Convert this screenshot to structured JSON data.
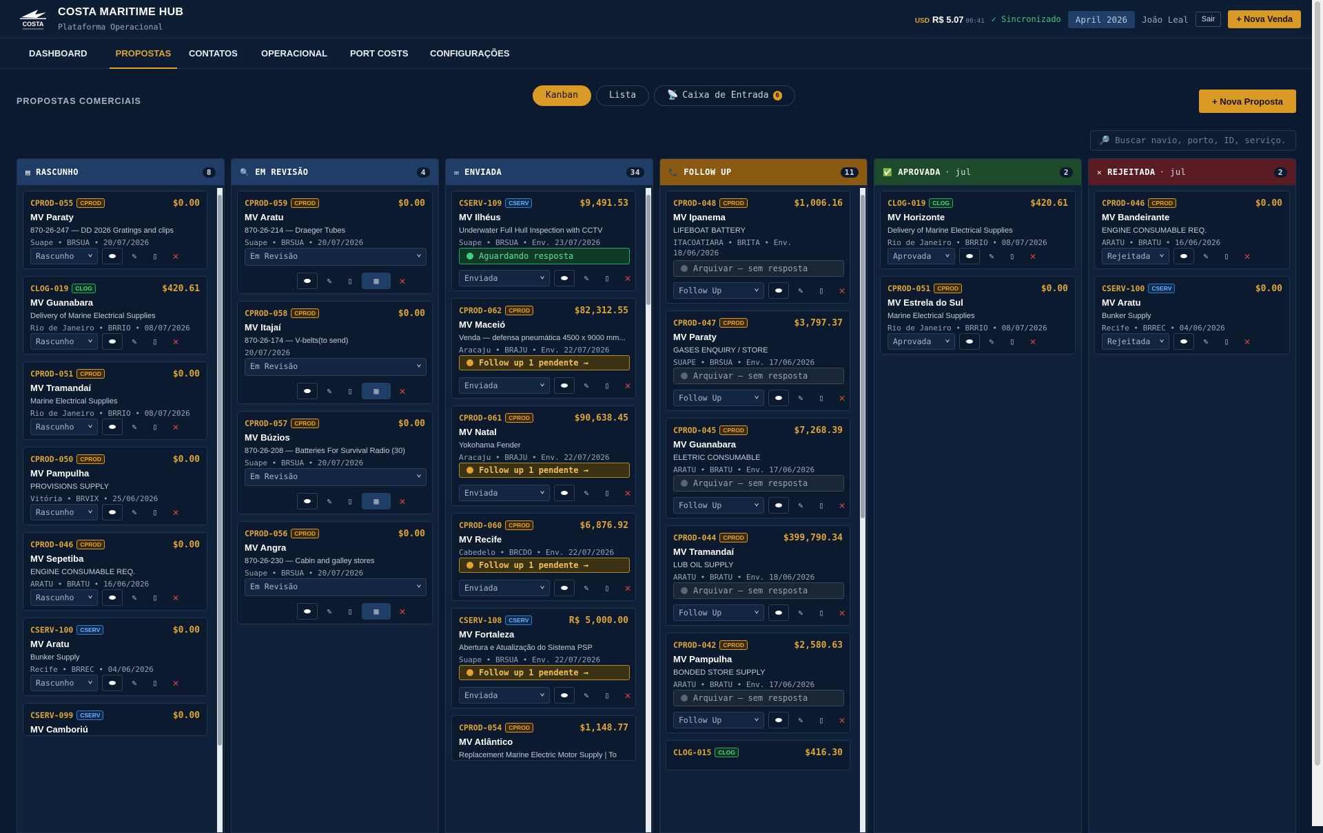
{
  "brand": {
    "title": "COSTA MARITIME HUB",
    "subtitle": "Plataforma Operacional",
    "logo_text": "COSTA"
  },
  "topbar": {
    "rate_currency": "USD",
    "rate_value": "R$ 5.07",
    "rate_time": "00:41",
    "sync": "✓ Sincronizado",
    "month": "April 2026",
    "user": "João Leal",
    "logout": "Sair",
    "new_sale": "+ Nova Venda"
  },
  "nav": [
    "DASHBOARD",
    "PROPOSTAS",
    "CONTATOS",
    "OPERACIONAL",
    "PORT COSTS",
    "CONFIGURAÇÕES"
  ],
  "page": {
    "title": "PROPOSTAS COMERCIAIS",
    "new_proposal": "+ Nova Proposta",
    "search_placeholder": "🔎 Buscar navio, porto, ID, serviço.",
    "views": [
      "Kanban",
      "Lista"
    ],
    "inbox": "Caixa de Entrada",
    "inbox_count": "6"
  },
  "columns": [
    {
      "title": "RASCUNHO",
      "sub": "",
      "count": "8",
      "color": "#1f3d66",
      "icon": "▤"
    },
    {
      "title": "EM REVISÃO",
      "sub": "",
      "count": "4",
      "color": "#1f3d66",
      "icon": "🔍"
    },
    {
      "title": "ENVIADA",
      "sub": "",
      "count": "34",
      "color": "#1f3d66",
      "icon": "✉"
    },
    {
      "title": "FOLLOW UP",
      "sub": "",
      "count": "11",
      "color": "#8a5a12",
      "icon": "📞"
    },
    {
      "title": "APROVADA",
      "sub": "· jul",
      "count": "2",
      "color": "#1d4a2a",
      "icon": "✅"
    },
    {
      "title": "REJEITADA",
      "sub": "· jul",
      "count": "2",
      "color": "#5a1c22",
      "icon": "✕"
    }
  ],
  "cards": {
    "rascunho": [
      {
        "id": "CPROD-055",
        "tag": "CPROD",
        "value": "$0.00",
        "ship": "MV Paraty",
        "desc": "870-26-247 — DD 2026 Gratings and clips",
        "meta": "Suape • BRSUA • 20/07/2026",
        "status": "Rascunho"
      },
      {
        "id": "CLOG-019",
        "tag": "CLOG",
        "value": "$420.61",
        "ship": "MV Guanabara",
        "desc": "Delivery of Marine Electrical Supplies",
        "meta": "Rio de Janeiro • BRRIO • 08/07/2026",
        "status": "Rascunho"
      },
      {
        "id": "CPROD-051",
        "tag": "CPROD",
        "value": "$0.00",
        "ship": "MV Tramandaí",
        "desc": "Marine Electrical Supplies",
        "meta": "Rio de Janeiro • BRRIO • 08/07/2026",
        "status": "Rascunho"
      },
      {
        "id": "CPROD-050",
        "tag": "CPROD",
        "value": "$0.00",
        "ship": "MV Pampulha",
        "desc": "PROVISIONS SUPPLY",
        "meta": "Vitória • BRVIX • 25/06/2026",
        "status": "Rascunho"
      },
      {
        "id": "CPROD-046",
        "tag": "CPROD",
        "value": "$0.00",
        "ship": "MV Sepetiba",
        "desc": "ENGINE CONSUMABLE REQ.",
        "meta": "ARATU • BRATU • 16/06/2026",
        "status": "Rascunho"
      },
      {
        "id": "CSERV-100",
        "tag": "CSERV",
        "value": "$0.00",
        "ship": "MV Aratu",
        "desc": "Bunker Supply",
        "meta": "Recife • BRREC • 04/06/2026",
        "status": "Rascunho"
      },
      {
        "id": "CSERV-099",
        "tag": "CSERV",
        "value": "$0.00",
        "ship": "MV Camboriú",
        "desc": "",
        "meta": "",
        "status": ""
      }
    ],
    "revisao": [
      {
        "id": "CPROD-059",
        "tag": "CPROD",
        "value": "$0.00",
        "ship": "MV Aratu",
        "desc": "870-26-214 — Draeger Tubes",
        "meta": "Suape • BRSUA • 20/07/2026",
        "status": "Em Revisão"
      },
      {
        "id": "CPROD-058",
        "tag": "CPROD",
        "value": "$0.00",
        "ship": "MV Itajaí",
        "desc": "870-26-174 — V-belts(to send)",
        "meta": "20/07/2026",
        "status": "Em Revisão"
      },
      {
        "id": "CPROD-057",
        "tag": "CPROD",
        "value": "$0.00",
        "ship": "MV Búzios",
        "desc": "870-26-208 — Batteries For Survival Radio (30)",
        "meta": "Suape • BRSUA • 20/07/2026",
        "status": "Em Revisão"
      },
      {
        "id": "CPROD-056",
        "tag": "CPROD",
        "value": "$0.00",
        "ship": "MV Angra",
        "desc": "870-26-230 — Cabin and galley stores",
        "meta": "Suape • BRSUA • 20/07/2026",
        "status": "Em Revisão"
      }
    ],
    "enviada": [
      {
        "id": "CSERV-109",
        "tag": "CSERV",
        "value": "$9,491.53",
        "ship": "MV Ilhéus",
        "desc": "Underwater Full Hull Inspection with CCTV",
        "meta": "Suape • BRSUA • Env. 23/07/2026",
        "note": "Aguardando resposta",
        "status": "Enviada"
      },
      {
        "id": "CPROD-062",
        "tag": "CPROD",
        "value": "$82,312.55",
        "ship": "MV Maceió",
        "desc": "Venda — defensa pneumática 4500 x 9000 mm...",
        "meta": "Aracaju • BRAJU • Env. 22/07/2026",
        "note": "Follow up 1 pendente →",
        "status": "Enviada"
      },
      {
        "id": "CPROD-061",
        "tag": "CPROD",
        "value": "$90,638.45",
        "ship": "MV Natal",
        "desc": "Yokohama Fender",
        "meta": "Aracaju • BRAJU • Env. 22/07/2026",
        "note": "Follow up 1 pendente →",
        "status": "Enviada"
      },
      {
        "id": "CPROD-060",
        "tag": "CPROD",
        "value": "$6,876.92",
        "ship": "MV Recife",
        "desc": "",
        "meta": "Cabedelo • BRCDO • Env. 22/07/2026",
        "note": "Follow up 1 pendente →",
        "status": "Enviada"
      },
      {
        "id": "CSERV-108",
        "tag": "CSERV",
        "value": "R$ 5,000.00",
        "ship": "MV Fortaleza",
        "desc": "Abertura e Atualização do Sistema PSP",
        "meta": "Suape • BRSUA • Env. 22/07/2026",
        "note": "Follow up 1 pendente →",
        "status": "Enviada"
      },
      {
        "id": "CPROD-054",
        "tag": "CPROD",
        "value": "$1,148.77",
        "ship": "MV Atlântico",
        "desc": "Replacement Marine Electric Motor Supply | To",
        "meta": "",
        "note": "",
        "status": ""
      }
    ],
    "followup": [
      {
        "id": "CPROD-048",
        "tag": "CPROD",
        "value": "$1,006.16",
        "ship": "MV Ipanema",
        "desc": "LIFEBOAT BATTERY",
        "meta1": "ITACOATIARA • BRITA • Env.",
        "meta2": "18/06/2026",
        "note": "Arquivar — sem resposta",
        "status": "Follow Up"
      },
      {
        "id": "CPROD-047",
        "tag": "CPROD",
        "value": "$3,797.37",
        "ship": "MV Paraty",
        "desc": "GASES ENQUIRY / STORE",
        "meta1": "SUAPE • BRSUA • Env. 17/06/2026",
        "meta2": "",
        "note": "Arquivar — sem resposta",
        "status": "Follow Up"
      },
      {
        "id": "CPROD-045",
        "tag": "CPROD",
        "value": "$7,268.39",
        "ship": "MV Guanabara",
        "desc": "ELETRIC CONSUMABLE",
        "meta1": "ARATU • BRATU • Env. 17/06/2026",
        "meta2": "",
        "note": "Arquivar — sem resposta",
        "status": "Follow Up"
      },
      {
        "id": "CPROD-044",
        "tag": "CPROD",
        "value": "$399,790.34",
        "ship": "MV Tramandaí",
        "desc": "LUB OIL SUPPLY",
        "meta1": "ARATU • BRATU • Env. 18/06/2026",
        "meta2": "",
        "note": "Arquivar — sem resposta",
        "status": "Follow Up"
      },
      {
        "id": "CPROD-042",
        "tag": "CPROD",
        "value": "$2,580.63",
        "ship": "MV Pampulha",
        "desc": "BONDED STORE SUPPLY",
        "meta1": "ARATU • BRATU • Env. 17/06/2026",
        "meta2": "",
        "note": "Arquivar — sem resposta",
        "status": "Follow Up"
      },
      {
        "id": "CLOG-015",
        "tag": "CLOG",
        "value": "$416.30",
        "ship": "",
        "desc": "",
        "meta1": "",
        "meta2": "",
        "note": "",
        "status": ""
      }
    ],
    "aprovada": [
      {
        "id": "CLOG-019",
        "tag": "CLOG",
        "value": "$420.61",
        "ship": "MV Horizonte",
        "desc": "Delivery of Marine Electrical Supplies",
        "meta": "Rio de Janeiro • BRRIO • 08/07/2026",
        "status": "Aprovada"
      },
      {
        "id": "CPROD-051",
        "tag": "CPROD",
        "value": "$0.00",
        "ship": "MV Estrela do Sul",
        "desc": "Marine Electrical Supplies",
        "meta": "Rio de Janeiro • BRRIO • 08/07/2026",
        "status": "Aprovada"
      }
    ],
    "rejeitada": [
      {
        "id": "CPROD-046",
        "tag": "CPROD",
        "value": "$0.00",
        "ship": "MV Bandeirante",
        "desc": "ENGINE CONSUMABLE REQ.",
        "meta": "ARATU • BRATU • 16/06/2026",
        "status": "Rejeitada"
      },
      {
        "id": "CSERV-100",
        "tag": "CSERV",
        "value": "$0.00",
        "ship": "MV Aratu",
        "desc": "Bunker Supply",
        "meta": "Recife • BRREC • 04/06/2026",
        "status": "Rejeitada"
      }
    ]
  }
}
